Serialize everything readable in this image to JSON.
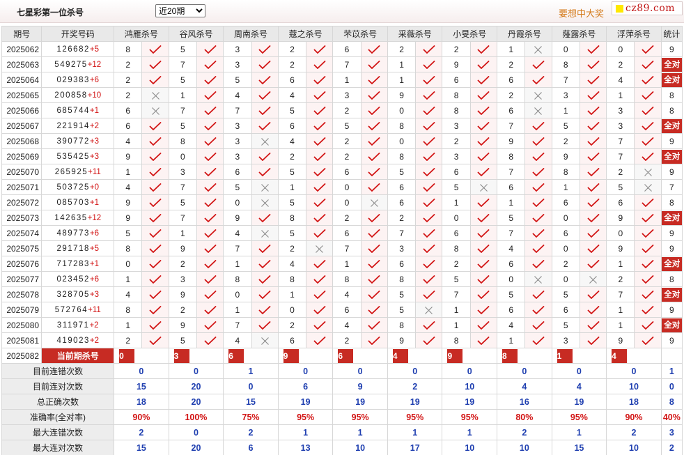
{
  "page": {
    "title": "七星彩第一位杀号",
    "period_select": "近20期",
    "promo_text": "要想中大奖",
    "site_logo": "cz89.com"
  },
  "table": {
    "headers": [
      "期号",
      "开奖号码",
      "鸿雁杀号",
      "谷风杀号",
      "周南杀号",
      "蔻之杀号",
      "芣苡杀号",
      "采薇杀号",
      "小旻杀号",
      "丹霞杀号",
      "薤露杀号",
      "浮萍杀号",
      "统计"
    ],
    "rows": [
      {
        "period": "2025062",
        "digits": "126682",
        "sum": "+5",
        "kills": [
          8,
          5,
          3,
          2,
          6,
          2,
          2,
          1,
          0,
          0
        ],
        "hits": [
          1,
          1,
          1,
          1,
          1,
          1,
          1,
          0,
          1,
          1
        ],
        "stat": "9"
      },
      {
        "period": "2025063",
        "digits": "549275",
        "sum": "+12",
        "kills": [
          2,
          7,
          3,
          2,
          7,
          1,
          9,
          2,
          8,
          2
        ],
        "hits": [
          1,
          1,
          1,
          1,
          1,
          1,
          1,
          1,
          1,
          1
        ],
        "stat": "全对"
      },
      {
        "period": "2025064",
        "digits": "029383",
        "sum": "+6",
        "kills": [
          2,
          5,
          5,
          6,
          1,
          1,
          6,
          6,
          7,
          4
        ],
        "hits": [
          1,
          1,
          1,
          1,
          1,
          1,
          1,
          1,
          1,
          1
        ],
        "stat": "全对"
      },
      {
        "period": "2025065",
        "digits": "200858",
        "sum": "+10",
        "kills": [
          2,
          1,
          4,
          4,
          3,
          9,
          8,
          2,
          3,
          1
        ],
        "hits": [
          0,
          1,
          1,
          1,
          1,
          1,
          1,
          0,
          1,
          1
        ],
        "stat": "8"
      },
      {
        "period": "2025066",
        "digits": "685744",
        "sum": "+1",
        "kills": [
          6,
          7,
          7,
          5,
          2,
          0,
          8,
          6,
          1,
          3
        ],
        "hits": [
          0,
          1,
          1,
          1,
          1,
          1,
          1,
          0,
          1,
          1
        ],
        "stat": "8"
      },
      {
        "period": "2025067",
        "digits": "221914",
        "sum": "+2",
        "kills": [
          6,
          5,
          3,
          6,
          5,
          8,
          3,
          7,
          5,
          3
        ],
        "hits": [
          1,
          1,
          1,
          1,
          1,
          1,
          1,
          1,
          1,
          1
        ],
        "stat": "全对"
      },
      {
        "period": "2025068",
        "digits": "390772",
        "sum": "+3",
        "kills": [
          4,
          8,
          3,
          4,
          2,
          0,
          2,
          9,
          2,
          7
        ],
        "hits": [
          1,
          1,
          0,
          1,
          1,
          1,
          1,
          1,
          1,
          1
        ],
        "stat": "9"
      },
      {
        "period": "2025069",
        "digits": "535425",
        "sum": "+3",
        "kills": [
          9,
          0,
          3,
          2,
          2,
          8,
          3,
          8,
          9,
          7
        ],
        "hits": [
          1,
          1,
          1,
          1,
          1,
          1,
          1,
          1,
          1,
          1
        ],
        "stat": "全对"
      },
      {
        "period": "2025070",
        "digits": "265925",
        "sum": "+11",
        "kills": [
          1,
          3,
          6,
          5,
          6,
          5,
          6,
          7,
          8,
          2
        ],
        "hits": [
          1,
          1,
          1,
          1,
          1,
          1,
          1,
          1,
          1,
          0
        ],
        "stat": "9"
      },
      {
        "period": "2025071",
        "digits": "503725",
        "sum": "+0",
        "kills": [
          4,
          7,
          5,
          1,
          0,
          6,
          5,
          6,
          1,
          5
        ],
        "hits": [
          1,
          1,
          0,
          1,
          1,
          1,
          0,
          1,
          1,
          0
        ],
        "stat": "7"
      },
      {
        "period": "2025072",
        "digits": "085703",
        "sum": "+1",
        "kills": [
          9,
          5,
          0,
          5,
          0,
          6,
          1,
          1,
          6,
          6
        ],
        "hits": [
          1,
          1,
          0,
          1,
          0,
          1,
          1,
          1,
          1,
          1
        ],
        "stat": "8"
      },
      {
        "period": "2025073",
        "digits": "142635",
        "sum": "+12",
        "kills": [
          9,
          7,
          9,
          8,
          2,
          2,
          0,
          5,
          0,
          9
        ],
        "hits": [
          1,
          1,
          1,
          1,
          1,
          1,
          1,
          1,
          1,
          1
        ],
        "stat": "全对"
      },
      {
        "period": "2025074",
        "digits": "489773",
        "sum": "+6",
        "kills": [
          5,
          1,
          4,
          5,
          6,
          7,
          6,
          7,
          6,
          0
        ],
        "hits": [
          1,
          1,
          0,
          1,
          1,
          1,
          1,
          1,
          1,
          1
        ],
        "stat": "9"
      },
      {
        "period": "2025075",
        "digits": "291718",
        "sum": "+5",
        "kills": [
          8,
          9,
          7,
          2,
          7,
          3,
          8,
          4,
          0,
          9
        ],
        "hits": [
          1,
          1,
          1,
          0,
          1,
          1,
          1,
          1,
          1,
          1
        ],
        "stat": "9"
      },
      {
        "period": "2025076",
        "digits": "717283",
        "sum": "+1",
        "kills": [
          0,
          2,
          1,
          4,
          1,
          6,
          2,
          6,
          2,
          1
        ],
        "hits": [
          1,
          1,
          1,
          1,
          1,
          1,
          1,
          1,
          1,
          1
        ],
        "stat": "全对"
      },
      {
        "period": "2025077",
        "digits": "023452",
        "sum": "+6",
        "kills": [
          1,
          3,
          8,
          8,
          8,
          8,
          5,
          0,
          0,
          2
        ],
        "hits": [
          1,
          1,
          1,
          1,
          1,
          1,
          1,
          0,
          0,
          1
        ],
        "stat": "8"
      },
      {
        "period": "2025078",
        "digits": "328705",
        "sum": "+3",
        "kills": [
          4,
          9,
          0,
          1,
          4,
          5,
          7,
          5,
          5,
          7
        ],
        "hits": [
          1,
          1,
          1,
          1,
          1,
          1,
          1,
          1,
          1,
          1
        ],
        "stat": "全对"
      },
      {
        "period": "2025079",
        "digits": "572764",
        "sum": "+11",
        "kills": [
          8,
          2,
          1,
          0,
          6,
          5,
          1,
          6,
          6,
          1
        ],
        "hits": [
          1,
          1,
          1,
          1,
          1,
          0,
          1,
          1,
          1,
          1
        ],
        "stat": "9"
      },
      {
        "period": "2025080",
        "digits": "311971",
        "sum": "+2",
        "kills": [
          1,
          9,
          7,
          2,
          4,
          8,
          1,
          4,
          5,
          1
        ],
        "hits": [
          1,
          1,
          1,
          1,
          1,
          1,
          1,
          1,
          1,
          1
        ],
        "stat": "全对"
      },
      {
        "period": "2025081",
        "digits": "419023",
        "sum": "+2",
        "kills": [
          2,
          5,
          4,
          6,
          2,
          9,
          8,
          1,
          3,
          9
        ],
        "hits": [
          1,
          1,
          0,
          1,
          1,
          1,
          1,
          1,
          1,
          1
        ],
        "stat": "9"
      }
    ],
    "current": {
      "period": "2025082",
      "label": "当前期杀号",
      "kills": [
        0,
        3,
        6,
        9,
        6,
        4,
        9,
        8,
        1,
        4
      ]
    },
    "summary": [
      {
        "label": "目前连错次数",
        "values": [
          "0",
          "0",
          "1",
          "0",
          "0",
          "0",
          "0",
          "0",
          "0",
          "0",
          "1"
        ],
        "color": "blue"
      },
      {
        "label": "目前连对次数",
        "values": [
          "15",
          "20",
          "0",
          "6",
          "9",
          "2",
          "10",
          "4",
          "4",
          "10",
          "0"
        ],
        "color": "blue"
      },
      {
        "label": "总正确次数",
        "values": [
          "18",
          "20",
          "15",
          "19",
          "19",
          "19",
          "19",
          "16",
          "19",
          "18",
          "8"
        ],
        "color": "blue"
      },
      {
        "label": "准确率(全对率)",
        "values": [
          "90%",
          "100%",
          "75%",
          "95%",
          "95%",
          "95%",
          "95%",
          "80%",
          "95%",
          "90%",
          "40%"
        ],
        "color": "red"
      },
      {
        "label": "最大连错次数",
        "values": [
          "2",
          "0",
          "2",
          "1",
          "1",
          "1",
          "1",
          "2",
          "1",
          "2",
          "3"
        ],
        "color": "blue"
      },
      {
        "label": "最大连对次数",
        "values": [
          "15",
          "20",
          "6",
          "13",
          "10",
          "17",
          "10",
          "10",
          "15",
          "10",
          "2"
        ],
        "color": "blue"
      }
    ]
  },
  "colors": {
    "accent_red": "#c72b23",
    "check_red": "#d21414",
    "cross_gray": "#8a8a8a",
    "summary_blue": "#1f3fb0"
  },
  "icons": {
    "hit": "check-icon",
    "miss": "cross-icon"
  }
}
